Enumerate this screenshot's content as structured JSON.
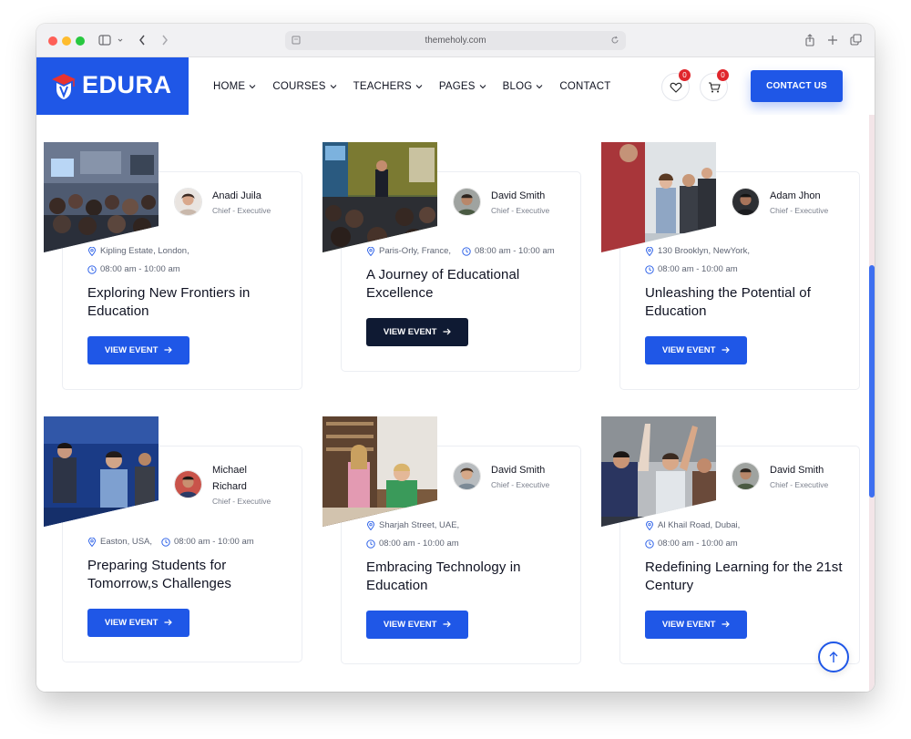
{
  "browser": {
    "url": "themeholy.com"
  },
  "header": {
    "logo_text": "EDURA",
    "nav": [
      "HOME",
      "COURSES",
      "TEACHERS",
      "PAGES",
      "BLOG",
      "CONTACT"
    ],
    "wishlist_count": "0",
    "cart_count": "0",
    "contact_label": "CONTACT US"
  },
  "events": [
    {
      "name": "Anadi Juila",
      "role": "Chief - Executive",
      "location": "Kipling Estate, London,",
      "time": "08:00 am - 10:00 am",
      "title": "Exploring New Frontiers in Education",
      "button": "VIEW EVENT"
    },
    {
      "name": "David Smith",
      "role": "Chief - Executive",
      "location": "Paris-Orly, France,",
      "time": "08:00 am - 10:00 am",
      "title": "A Journey of Educational Excellence",
      "button": "VIEW EVENT"
    },
    {
      "name": "Adam Jhon",
      "role": "Chief - Executive",
      "location": "130 Brooklyn, NewYork,",
      "time": "08:00 am - 10:00 am",
      "title": "Unleashing the Potential of Education",
      "button": "VIEW EVENT"
    },
    {
      "name": "Michael Richard",
      "role": "Chief - Executive",
      "location": "Easton, USA,",
      "time": "08:00 am - 10:00 am",
      "title": "Preparing Students for Tomorrow,s Challenges",
      "button": "VIEW EVENT"
    },
    {
      "name": "David Smith",
      "role": "Chief - Executive",
      "location": "Sharjah Street, UAE,",
      "time": "08:00 am - 10:00 am",
      "title": "Embracing Technology in Education",
      "button": "VIEW EVENT"
    },
    {
      "name": "David Smith",
      "role": "Chief - Executive",
      "location": "Al Khail Road, Dubai,",
      "time": "08:00 am - 10:00 am",
      "title": "Redefining Learning for the 21st Century",
      "button": "VIEW EVENT"
    }
  ],
  "colors": {
    "primary": "#1f57e7",
    "dark": "#0f1a33",
    "badge": "#e0262c"
  }
}
